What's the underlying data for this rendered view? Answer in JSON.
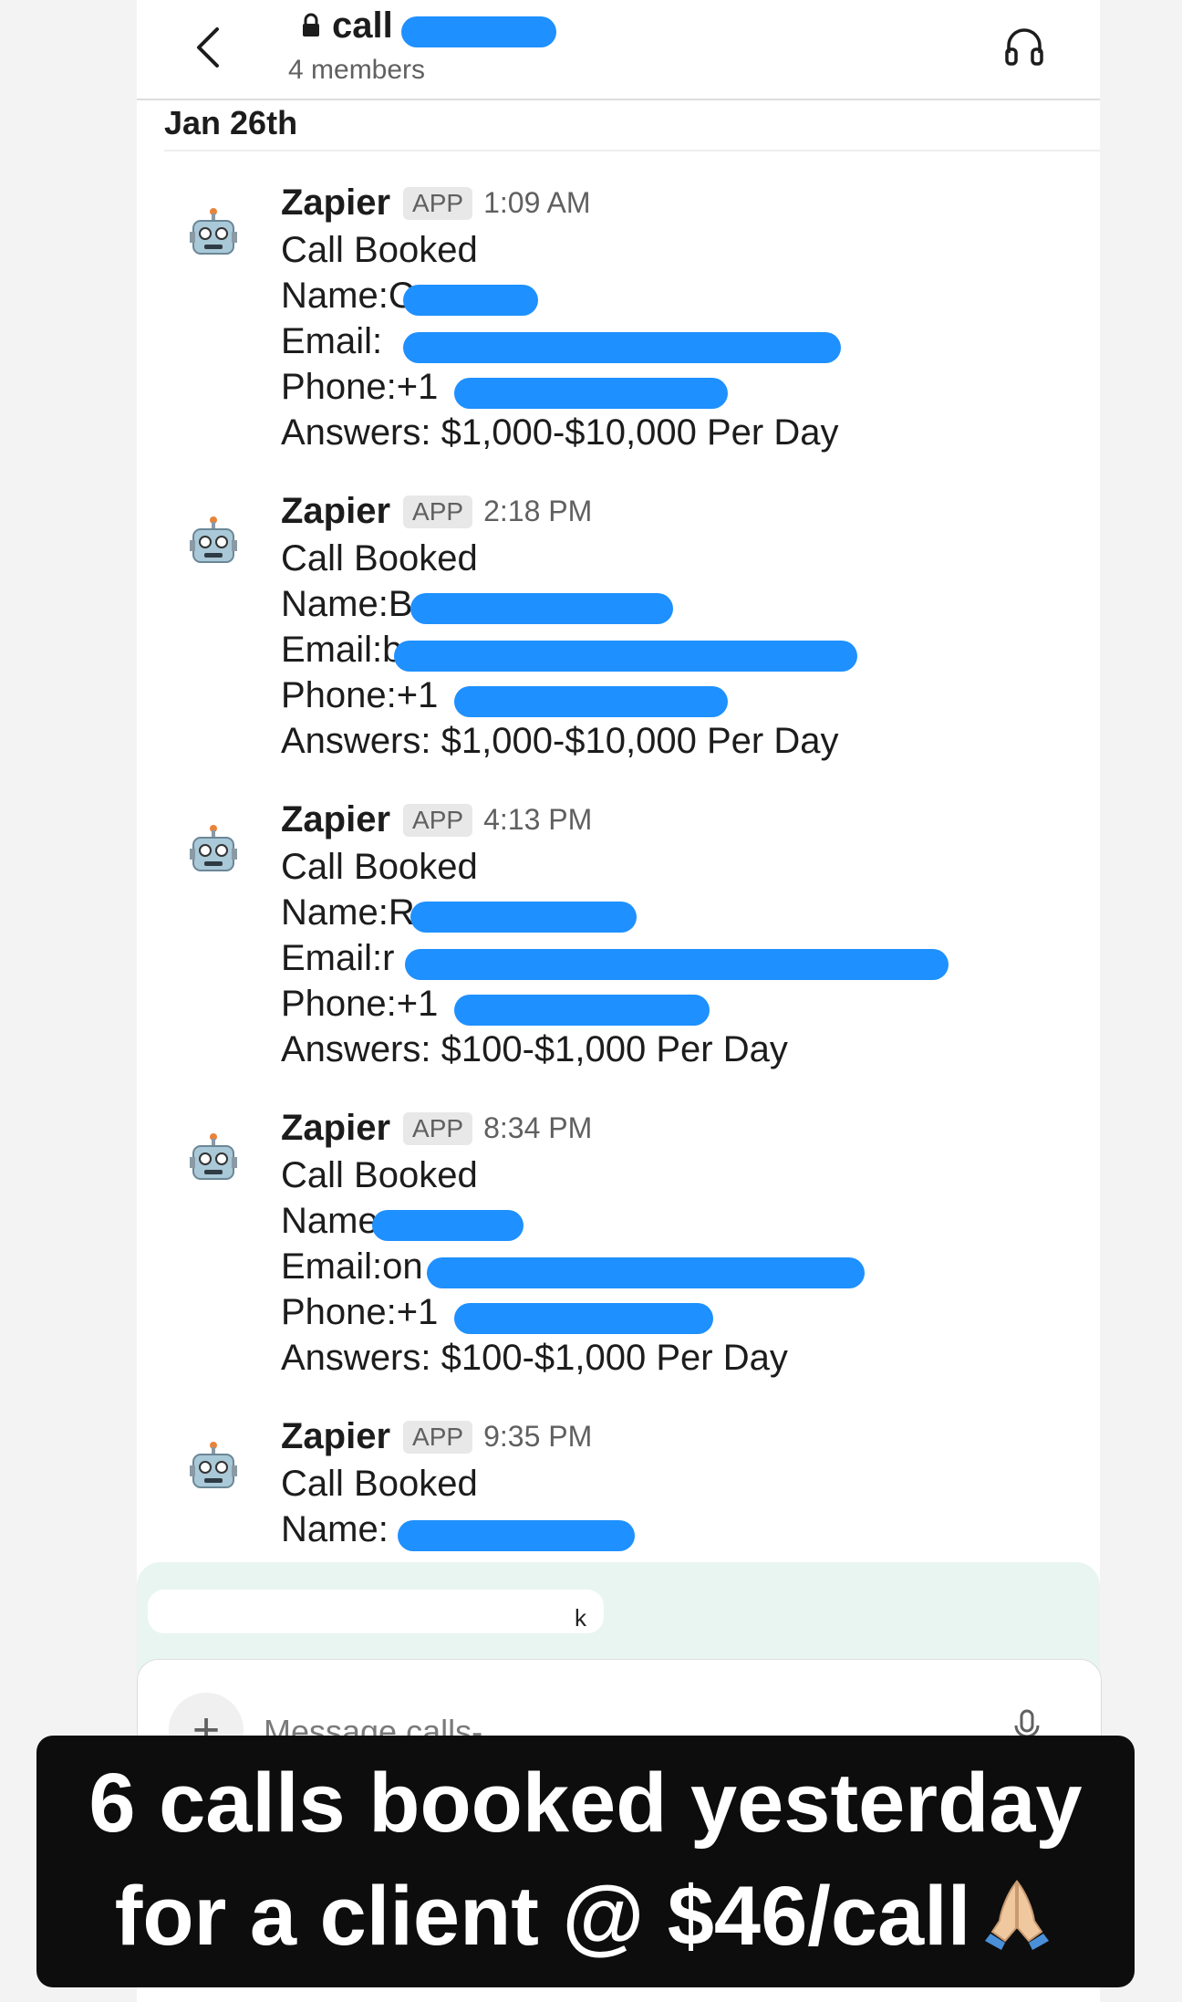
{
  "header": {
    "channel_name": "call",
    "members": "4 members"
  },
  "date_divider": "Jan 26th",
  "messages": [
    {
      "sender": "Zapier",
      "badge": "APP",
      "time": "1:09 AM",
      "line1": "Call Booked",
      "name": "Name:C",
      "email": "Email:",
      "phone": "Phone:+1",
      "answers": "Answers: $1,000-$10,000 Per Day"
    },
    {
      "sender": "Zapier",
      "badge": "APP",
      "time": "2:18 PM",
      "line1": "Call Booked",
      "name": "Name:B",
      "email": "Email:b",
      "phone": "Phone:+1",
      "answers": "Answers: $1,000-$10,000 Per Day"
    },
    {
      "sender": "Zapier",
      "badge": "APP",
      "time": "4:13 PM",
      "line1": "Call Booked",
      "name": "Name:R",
      "email": "Email:r",
      "phone": "Phone:+1",
      "answers": "Answers: $100-$1,000 Per Day"
    },
    {
      "sender": "Zapier",
      "badge": "APP",
      "time": "8:34 PM",
      "line1": "Call Booked",
      "name": "Name",
      "email": "Email:on",
      "phone": "Phone:+1",
      "answers": "Answers: $100-$1,000 Per Day"
    },
    {
      "sender": "Zapier",
      "badge": "APP",
      "time": "9:35 PM",
      "line1": "Call Booked",
      "name": "Name:",
      "email": "",
      "phone": "",
      "answers": ""
    }
  ],
  "composer": {
    "chip_text": "k",
    "placeholder": "Message calls-"
  },
  "caption": {
    "line1": "6 calls booked yesterday",
    "line2": "for a client @ $46/call"
  },
  "colors": {
    "redaction": "#1e90ff",
    "composer_bg": "#e9f5f1",
    "caption_bg": "#0d0d0d"
  },
  "icons": [
    "back-chevron-icon",
    "lock-icon",
    "headphones-icon",
    "robot-avatar-icon",
    "plus-icon",
    "microphone-icon",
    "praying-hands-icon"
  ]
}
